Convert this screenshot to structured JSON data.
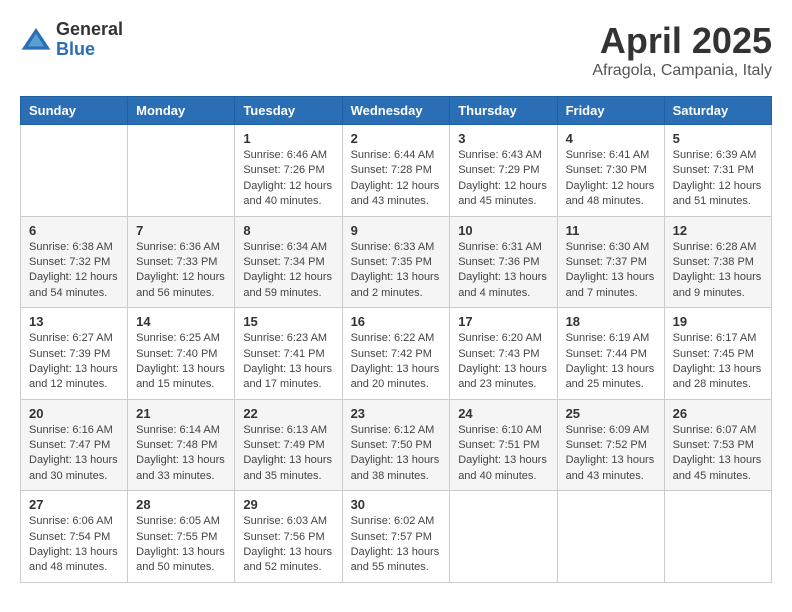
{
  "logo": {
    "general": "General",
    "blue": "Blue"
  },
  "title": "April 2025",
  "location": "Afragola, Campania, Italy",
  "days_of_week": [
    "Sunday",
    "Monday",
    "Tuesday",
    "Wednesday",
    "Thursday",
    "Friday",
    "Saturday"
  ],
  "weeks": [
    [
      {
        "day": "",
        "sunrise": "",
        "sunset": "",
        "daylight": ""
      },
      {
        "day": "",
        "sunrise": "",
        "sunset": "",
        "daylight": ""
      },
      {
        "day": "1",
        "sunrise": "Sunrise: 6:46 AM",
        "sunset": "Sunset: 7:26 PM",
        "daylight": "Daylight: 12 hours and 40 minutes."
      },
      {
        "day": "2",
        "sunrise": "Sunrise: 6:44 AM",
        "sunset": "Sunset: 7:28 PM",
        "daylight": "Daylight: 12 hours and 43 minutes."
      },
      {
        "day": "3",
        "sunrise": "Sunrise: 6:43 AM",
        "sunset": "Sunset: 7:29 PM",
        "daylight": "Daylight: 12 hours and 45 minutes."
      },
      {
        "day": "4",
        "sunrise": "Sunrise: 6:41 AM",
        "sunset": "Sunset: 7:30 PM",
        "daylight": "Daylight: 12 hours and 48 minutes."
      },
      {
        "day": "5",
        "sunrise": "Sunrise: 6:39 AM",
        "sunset": "Sunset: 7:31 PM",
        "daylight": "Daylight: 12 hours and 51 minutes."
      }
    ],
    [
      {
        "day": "6",
        "sunrise": "Sunrise: 6:38 AM",
        "sunset": "Sunset: 7:32 PM",
        "daylight": "Daylight: 12 hours and 54 minutes."
      },
      {
        "day": "7",
        "sunrise": "Sunrise: 6:36 AM",
        "sunset": "Sunset: 7:33 PM",
        "daylight": "Daylight: 12 hours and 56 minutes."
      },
      {
        "day": "8",
        "sunrise": "Sunrise: 6:34 AM",
        "sunset": "Sunset: 7:34 PM",
        "daylight": "Daylight: 12 hours and 59 minutes."
      },
      {
        "day": "9",
        "sunrise": "Sunrise: 6:33 AM",
        "sunset": "Sunset: 7:35 PM",
        "daylight": "Daylight: 13 hours and 2 minutes."
      },
      {
        "day": "10",
        "sunrise": "Sunrise: 6:31 AM",
        "sunset": "Sunset: 7:36 PM",
        "daylight": "Daylight: 13 hours and 4 minutes."
      },
      {
        "day": "11",
        "sunrise": "Sunrise: 6:30 AM",
        "sunset": "Sunset: 7:37 PM",
        "daylight": "Daylight: 13 hours and 7 minutes."
      },
      {
        "day": "12",
        "sunrise": "Sunrise: 6:28 AM",
        "sunset": "Sunset: 7:38 PM",
        "daylight": "Daylight: 13 hours and 9 minutes."
      }
    ],
    [
      {
        "day": "13",
        "sunrise": "Sunrise: 6:27 AM",
        "sunset": "Sunset: 7:39 PM",
        "daylight": "Daylight: 13 hours and 12 minutes."
      },
      {
        "day": "14",
        "sunrise": "Sunrise: 6:25 AM",
        "sunset": "Sunset: 7:40 PM",
        "daylight": "Daylight: 13 hours and 15 minutes."
      },
      {
        "day": "15",
        "sunrise": "Sunrise: 6:23 AM",
        "sunset": "Sunset: 7:41 PM",
        "daylight": "Daylight: 13 hours and 17 minutes."
      },
      {
        "day": "16",
        "sunrise": "Sunrise: 6:22 AM",
        "sunset": "Sunset: 7:42 PM",
        "daylight": "Daylight: 13 hours and 20 minutes."
      },
      {
        "day": "17",
        "sunrise": "Sunrise: 6:20 AM",
        "sunset": "Sunset: 7:43 PM",
        "daylight": "Daylight: 13 hours and 23 minutes."
      },
      {
        "day": "18",
        "sunrise": "Sunrise: 6:19 AM",
        "sunset": "Sunset: 7:44 PM",
        "daylight": "Daylight: 13 hours and 25 minutes."
      },
      {
        "day": "19",
        "sunrise": "Sunrise: 6:17 AM",
        "sunset": "Sunset: 7:45 PM",
        "daylight": "Daylight: 13 hours and 28 minutes."
      }
    ],
    [
      {
        "day": "20",
        "sunrise": "Sunrise: 6:16 AM",
        "sunset": "Sunset: 7:47 PM",
        "daylight": "Daylight: 13 hours and 30 minutes."
      },
      {
        "day": "21",
        "sunrise": "Sunrise: 6:14 AM",
        "sunset": "Sunset: 7:48 PM",
        "daylight": "Daylight: 13 hours and 33 minutes."
      },
      {
        "day": "22",
        "sunrise": "Sunrise: 6:13 AM",
        "sunset": "Sunset: 7:49 PM",
        "daylight": "Daylight: 13 hours and 35 minutes."
      },
      {
        "day": "23",
        "sunrise": "Sunrise: 6:12 AM",
        "sunset": "Sunset: 7:50 PM",
        "daylight": "Daylight: 13 hours and 38 minutes."
      },
      {
        "day": "24",
        "sunrise": "Sunrise: 6:10 AM",
        "sunset": "Sunset: 7:51 PM",
        "daylight": "Daylight: 13 hours and 40 minutes."
      },
      {
        "day": "25",
        "sunrise": "Sunrise: 6:09 AM",
        "sunset": "Sunset: 7:52 PM",
        "daylight": "Daylight: 13 hours and 43 minutes."
      },
      {
        "day": "26",
        "sunrise": "Sunrise: 6:07 AM",
        "sunset": "Sunset: 7:53 PM",
        "daylight": "Daylight: 13 hours and 45 minutes."
      }
    ],
    [
      {
        "day": "27",
        "sunrise": "Sunrise: 6:06 AM",
        "sunset": "Sunset: 7:54 PM",
        "daylight": "Daylight: 13 hours and 48 minutes."
      },
      {
        "day": "28",
        "sunrise": "Sunrise: 6:05 AM",
        "sunset": "Sunset: 7:55 PM",
        "daylight": "Daylight: 13 hours and 50 minutes."
      },
      {
        "day": "29",
        "sunrise": "Sunrise: 6:03 AM",
        "sunset": "Sunset: 7:56 PM",
        "daylight": "Daylight: 13 hours and 52 minutes."
      },
      {
        "day": "30",
        "sunrise": "Sunrise: 6:02 AM",
        "sunset": "Sunset: 7:57 PM",
        "daylight": "Daylight: 13 hours and 55 minutes."
      },
      {
        "day": "",
        "sunrise": "",
        "sunset": "",
        "daylight": ""
      },
      {
        "day": "",
        "sunrise": "",
        "sunset": "",
        "daylight": ""
      },
      {
        "day": "",
        "sunrise": "",
        "sunset": "",
        "daylight": ""
      }
    ]
  ]
}
